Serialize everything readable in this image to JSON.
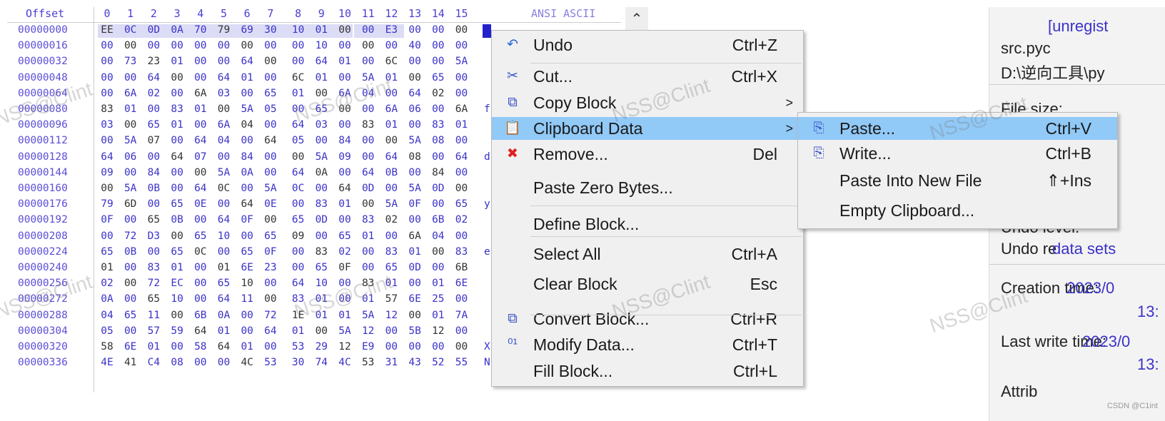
{
  "hex_editor": {
    "offset_header": "Offset",
    "column_headers": [
      "0",
      "1",
      "2",
      "3",
      "4",
      "5",
      "6",
      "7",
      "8",
      "9",
      "10",
      "11",
      "12",
      "13",
      "14",
      "15"
    ],
    "ascii_header": "ANSI ASCII",
    "rows": [
      {
        "offset": "00000000",
        "bytes": "EE 0C 0D 0A 70 79 69 30 10 01 00 00 E3 00 00 00",
        "ascii": ""
      },
      {
        "offset": "00000016",
        "bytes": "00 00 00 00 00 00 00 00 00 10 00 00 00 40 00 00",
        "ascii": ""
      },
      {
        "offset": "00000032",
        "bytes": "00 73 23 01 00 00 64 00 00 64 01 00 6C 00 00 5A",
        "ascii": ""
      },
      {
        "offset": "00000048",
        "bytes": "00 00 64 00 00 64 01 00 6C 01 00 5A 01 00 65 00",
        "ascii": ""
      },
      {
        "offset": "00000064",
        "bytes": "00 6A 02 00 6A 03 00 65 01 00 6A 04 00 64 02 00",
        "ascii": ""
      },
      {
        "offset": "00000080",
        "bytes": "83 01 00 83 01 00 5A 05 00 65 00 00 6A 06 00 6A",
        "ascii": "f"
      },
      {
        "offset": "00000096",
        "bytes": "03 00 65 01 00 6A 04 00 64 03 00 83 01 00 83 01",
        "ascii": ""
      },
      {
        "offset": "00000112",
        "bytes": "00 5A 07 00 64 04 00 64 05 00 84 00 00 5A 08 00",
        "ascii": ""
      },
      {
        "offset": "00000128",
        "bytes": "64 06 00 64 07 00 84 00 00 5A 09 00 64 08 00 64",
        "ascii": "d"
      },
      {
        "offset": "00000144",
        "bytes": "09 00 84 00 00 5A 0A 00 64 0A 00 64 0B 00 84 00",
        "ascii": ""
      },
      {
        "offset": "00000160",
        "bytes": "00 5A 0B 00 64 0C 00 5A 0C 00 64 0D 00 5A 0D 00",
        "ascii": ""
      },
      {
        "offset": "00000176",
        "bytes": "79 6D 00 65 0E 00 64 0E 00 83 01 00 5A 0F 00 65",
        "ascii": "y"
      },
      {
        "offset": "00000192",
        "bytes": "0F 00 65 0B 00 64 0F 00 65 0D 00 83 02 00 6B 02",
        "ascii": ""
      },
      {
        "offset": "00000208",
        "bytes": "00 72 D3 00 65 10 00 65 09 00 65 01 00 6A 04 00",
        "ascii": ""
      },
      {
        "offset": "00000224",
        "bytes": "65 0B 00 65 0C 00 65 0F 00 83 02 00 83 01 00 83",
        "ascii": "e"
      },
      {
        "offset": "00000240",
        "bytes": "01 00 83 01 00 01 6E 23 00 65 0F 00 65 0D 00 6B",
        "ascii": ""
      },
      {
        "offset": "00000256",
        "bytes": "02 00 72 EC 00 65 10 00 64 10 00 83 01 00 01 6E",
        "ascii": ""
      },
      {
        "offset": "00000272",
        "bytes": "0A 00 65 10 00 64 11 00 83 01 00 01 57 6E 25 00",
        "ascii": ""
      },
      {
        "offset": "00000288",
        "bytes": "04 65 11 00 6B 0A 00 72 1E 01 01 5A 12 00 01 7A",
        "ascii": ""
      },
      {
        "offset": "00000304",
        "bytes": "05 00 57 59 64 01 00 64 01 00 5A 12 00 5B 12 00",
        "ascii": ""
      },
      {
        "offset": "00000320",
        "bytes": "58 6E 01 00 58 64 01 00 53 29 12 E9 00 00 00 00",
        "ascii": "X"
      },
      {
        "offset": "00000336",
        "bytes": "4E 41 C4 08 00 00 4C 53 30 74 4C 53 31 43 52 55",
        "ascii": "N"
      }
    ],
    "scroll_up_icon": "chevron-up-icon"
  },
  "context_menu": {
    "items": [
      {
        "icon": "↶",
        "icon_name": "undo-icon",
        "label": "Undo",
        "shortcut": "Ctrl+Z"
      },
      {
        "icon": "✂",
        "icon_name": "scissors-icon",
        "label": "Cut...",
        "shortcut": "Ctrl+X"
      },
      {
        "icon": "⧉",
        "icon_name": "copy-icon",
        "label": "Copy Block",
        "shortcut": "",
        "submenu": ">"
      },
      {
        "icon": "📋",
        "icon_name": "clipboard-icon",
        "label": "Clipboard Data",
        "shortcut": "",
        "submenu": ">",
        "highlighted": true
      },
      {
        "icon": "✖",
        "icon_name": "remove-icon",
        "label": "Remove...",
        "shortcut": "Del"
      },
      {
        "icon": "",
        "label": "Paste Zero Bytes...",
        "shortcut": ""
      },
      {
        "icon": "",
        "label": "Define Block...",
        "shortcut": ""
      },
      {
        "icon": "",
        "label": "Select All",
        "shortcut": "Ctrl+A"
      },
      {
        "icon": "",
        "label": "Clear Block",
        "shortcut": "Esc"
      },
      {
        "icon": "⧉",
        "icon_name": "convert-icon",
        "label": "Convert Block...",
        "shortcut": "Ctrl+R"
      },
      {
        "icon": "⁰¹",
        "icon_name": "binary-modify-icon",
        "label": "Modify Data...",
        "shortcut": "Ctrl+T"
      },
      {
        "icon": "",
        "label": "Fill Block...",
        "shortcut": "Ctrl+L"
      }
    ]
  },
  "submenu": {
    "items": [
      {
        "icon": "⎘",
        "icon_name": "paste-icon",
        "label": "Paste...",
        "shortcut": "Ctrl+V",
        "highlighted": true
      },
      {
        "icon": "⎘",
        "icon_name": "write-icon",
        "label": "Write...",
        "shortcut": "Ctrl+B"
      },
      {
        "icon": "",
        "label": "Paste Into New File",
        "shortcut": "⇑+Ins"
      },
      {
        "icon": "",
        "label": "Empty Clipboard...",
        "shortcut": ""
      }
    ]
  },
  "info_panel": {
    "unregistered": "[unregist",
    "filename": "src.pyc",
    "path": "D:\\逆向工具\\py",
    "file_size_label": "File size:",
    "undo_level_label": "Undo level:",
    "undo_reverses_label": "Undo re",
    "undo_reverses_value": "data sets",
    "creation_label": "Creation time:",
    "creation_date": "2023/0",
    "creation_time": "13:",
    "last_write_label": "Last write time:",
    "last_write_date": "2023/0",
    "last_write_time": "13:",
    "attributes_label": "Attrib"
  },
  "watermark": "NSS@Clint",
  "credit": "CSDN @C1int"
}
